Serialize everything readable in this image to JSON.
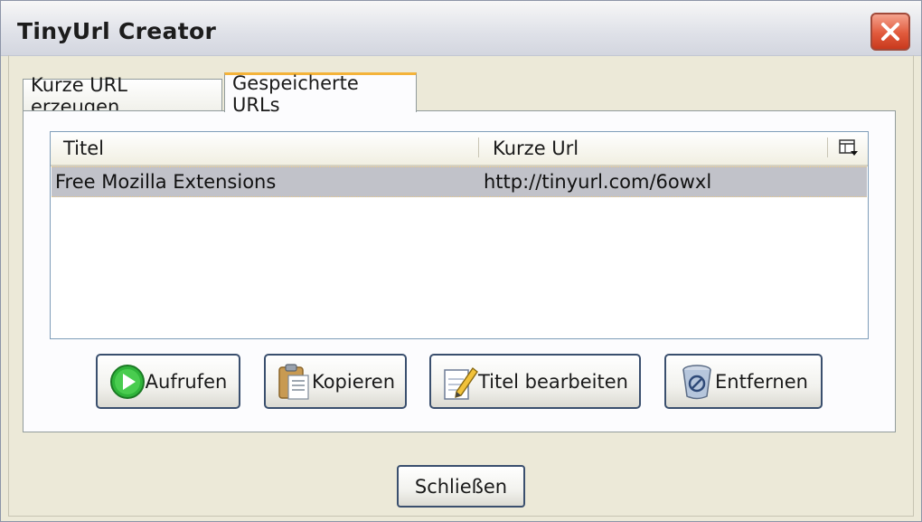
{
  "window": {
    "title": "TinyUrl Creator",
    "close_icon": "close-icon"
  },
  "tabs": [
    {
      "label": "Kurze URL erzeugen",
      "active": false
    },
    {
      "label": "Gespeicherte URLs",
      "active": true
    }
  ],
  "list": {
    "columns": [
      "Titel",
      "Kurze Url"
    ],
    "column_picker_icon": "column-picker-icon",
    "rows": [
      {
        "title": "Free Mozilla Extensions",
        "url": "http://tinyurl.com/6owxl",
        "selected": true
      }
    ]
  },
  "actions": {
    "open_label": "Aufrufen",
    "open_icon": "play-icon",
    "copy_label": "Kopieren",
    "copy_icon": "clipboard-icon",
    "edit_label": "Titel bearbeiten",
    "edit_icon": "edit-pencil-icon",
    "remove_label": "Entfernen",
    "remove_icon": "trash-icon"
  },
  "footer": {
    "close_label": "Schließen"
  },
  "colors": {
    "selection": "#c1c2c9",
    "active_tab_accent": "#f4b33a",
    "close_button": "#e15a3c"
  }
}
